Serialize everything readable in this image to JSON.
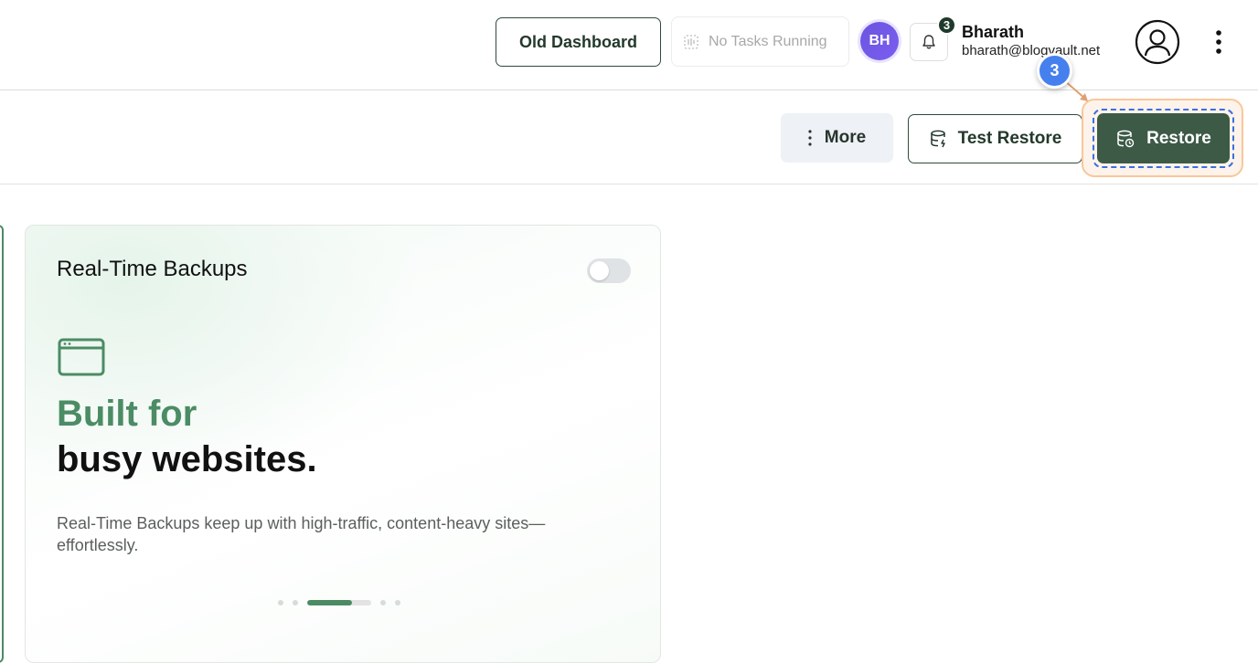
{
  "header": {
    "old_dashboard_label": "Old Dashboard",
    "tasks_status": "No Tasks Running",
    "avatar_initials": "BH",
    "notification_count": "3",
    "user_name": "Bharath",
    "user_email": "bharath@blogvault.net",
    "icons": [
      "tasks-icon",
      "bell-icon",
      "profile-icon",
      "kebab-menu-icon"
    ]
  },
  "toolbar": {
    "more_label": "More",
    "test_restore_label": "Test Restore",
    "restore_label": "Restore",
    "icons": [
      "vertical-dots-icon",
      "database-icon",
      "database-restore-icon"
    ]
  },
  "walkthrough": {
    "step_number": "3",
    "highlight_color": "#f8c79b",
    "marker_color": "#4580ee"
  },
  "card": {
    "title": "Real-Time Backups",
    "toggle_on": false,
    "headline_accent": "Built for",
    "headline_main": "busy websites.",
    "description": "Real-Time Backups keep up with high-traffic, content-heavy sites—effortlessly.",
    "carousel_progress": 0.7,
    "icon": "browser-window-icon"
  },
  "colors": {
    "brand_green": "#3d5a47",
    "accent_green": "#4b8c64",
    "avatar_purple": "#6b55e0"
  }
}
